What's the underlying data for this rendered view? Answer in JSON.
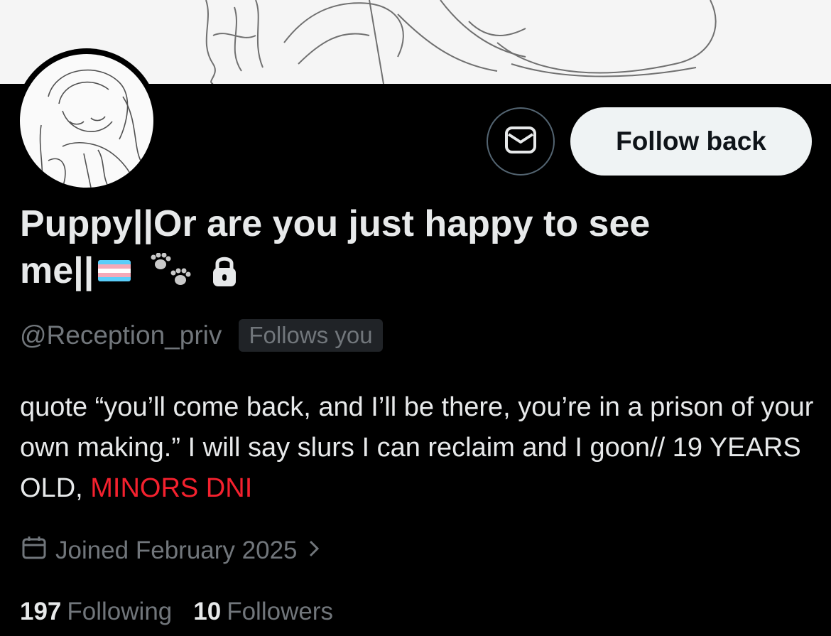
{
  "profile": {
    "display_name_line1": "Puppy||Or are you just happy to see",
    "display_name_line2": "me||",
    "handle": "@Reception_priv",
    "follows_you_badge": "Follows you",
    "bio_text": "quote “you’ll come back, and I’ll be there, you’re in a prison of your own making.” I will say slurs I can reclaim and I goon// 19 YEARS OLD, ",
    "bio_highlight": "MINORS DNI",
    "joined": "Joined February 2025",
    "following_count": "197",
    "following_label": "Following",
    "followers_count": "10",
    "followers_label": "Followers"
  },
  "actions": {
    "follow_back_label": "Follow back",
    "message_icon": "envelope-icon"
  },
  "icons": {
    "flag": "transgender-flag-icon",
    "paws": "paw-prints-icon",
    "lock": "lock-icon",
    "calendar": "calendar-icon",
    "chevron": "chevron-right-icon"
  },
  "colors": {
    "background": "#000000",
    "text": "#e7e9ea",
    "secondary_text": "#71767b",
    "button_bg": "#eff3f4",
    "highlight_red": "#f4212e"
  }
}
